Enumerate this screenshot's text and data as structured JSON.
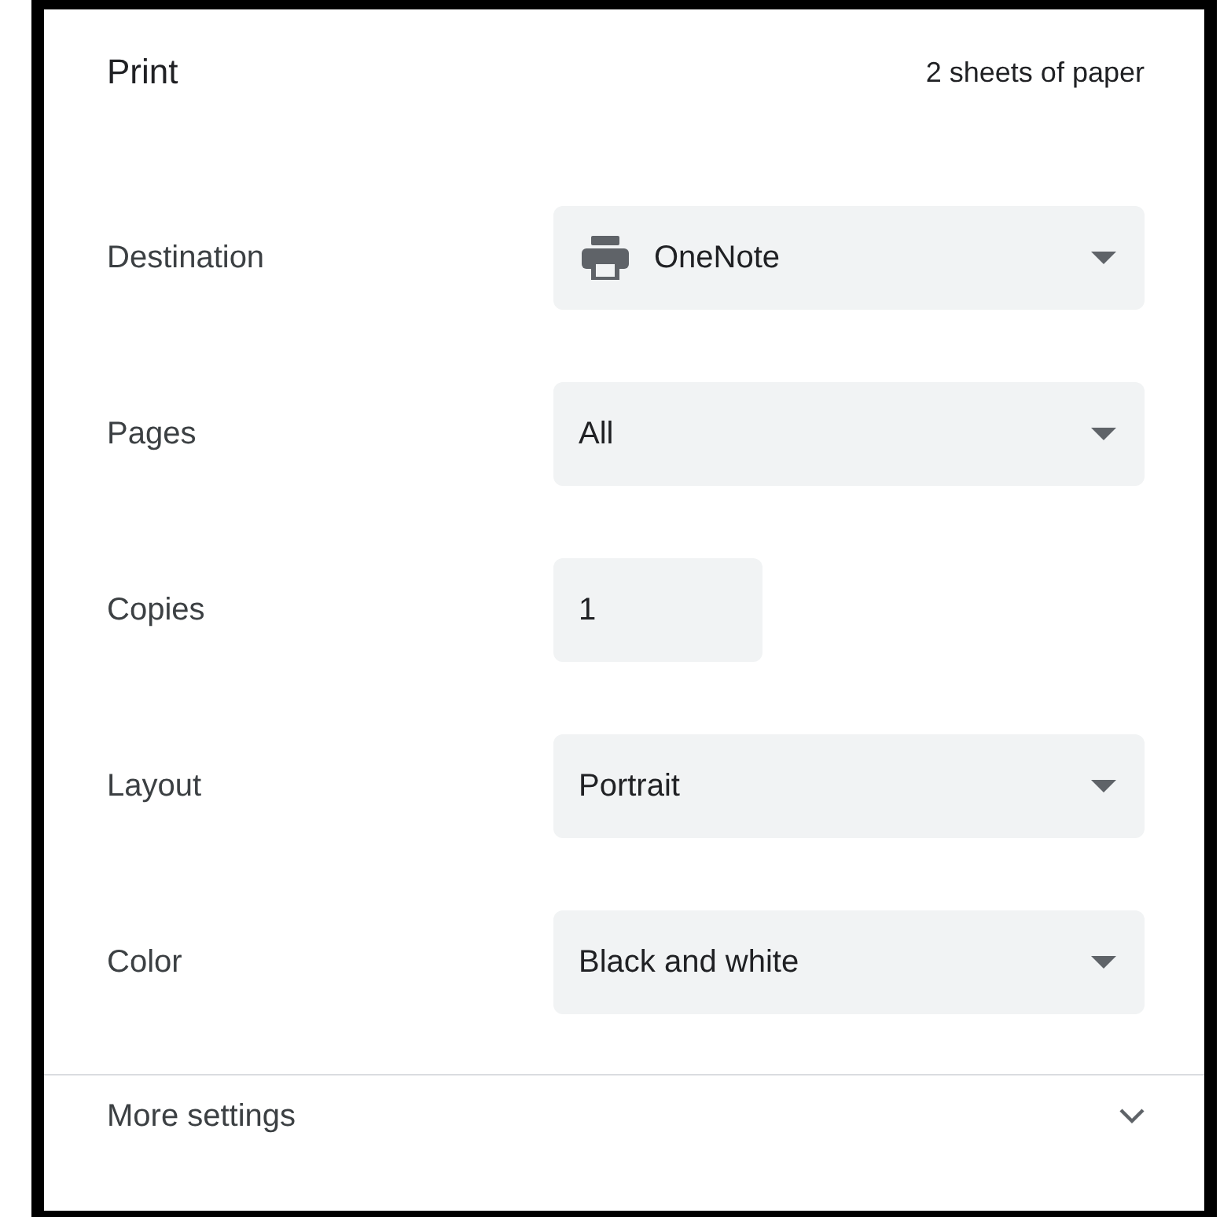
{
  "header": {
    "title": "Print",
    "sheet_count": "2 sheets of paper"
  },
  "settings": [
    {
      "label": "Destination",
      "kind": "device-select",
      "value": "OneNote"
    },
    {
      "label": "Pages",
      "kind": "select",
      "value": "All"
    },
    {
      "label": "Copies",
      "kind": "number",
      "value": "1"
    },
    {
      "label": "Layout",
      "kind": "select",
      "value": "Portrait"
    },
    {
      "label": "Color",
      "kind": "select",
      "value": "Black and white"
    }
  ],
  "more_settings": {
    "label": "More settings",
    "expanded": false
  }
}
